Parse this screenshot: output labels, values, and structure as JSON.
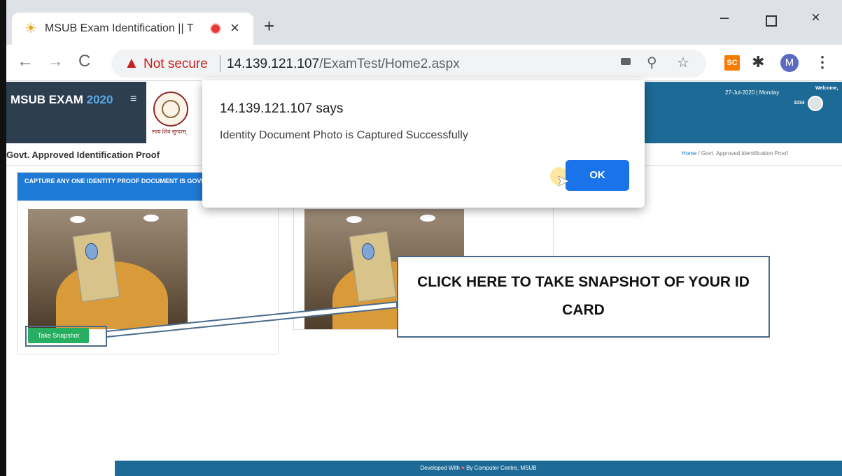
{
  "browser": {
    "tab_title": "MSUB Exam Identification || T",
    "tab_close": "×",
    "new_tab": "+",
    "window_minimize": "–",
    "window_close": "×",
    "nav_back": "←",
    "nav_forward": "→",
    "nav_reload": "C",
    "security_warning": "Not secure",
    "url_host": "14.139.121.107",
    "url_path": "/ExamTest/Home2.aspx",
    "extension_sc": "SC",
    "profile_initial": "M",
    "menu_glyph": "⋮",
    "icons": [
      "sun-favicon-icon",
      "recording-icon",
      "warning-icon",
      "camera-icon",
      "zoom-icon",
      "star-icon",
      "puzzle-icon"
    ]
  },
  "header": {
    "brand_name": "MSUB EXAM",
    "brand_year": "2020",
    "hamburger": "≡",
    "logo_caption": "सत्यं शिवं सुन्दरम्",
    "date": "27-Jul-2020 | Monday",
    "welcome": "Welcome,",
    "user_id": "1034"
  },
  "page": {
    "title": "Govt. Approved Identification Proof",
    "breadcrumb_home": "Home",
    "breadcrumb_sep": "/",
    "breadcrumb_current": "Govt. Approved Identification Proof"
  },
  "panel1": {
    "heading": "CAPTURE ANY ONE IDENTITY PROOF DOCUMENT IS GOVERNMENT",
    "snapshot_button": "Take Snapshot"
  },
  "callout": {
    "text": "CLICK HERE TO TAKE SNAPSHOT OF YOUR ID CARD"
  },
  "footer": {
    "prefix": "Developed With",
    "heart": "♥",
    "suffix": "By Computer Centre, MSUB"
  },
  "alert": {
    "title": "14.139.121.107 says",
    "message": "Identity Document Photo is Captured Successfully",
    "ok_label": "OK"
  },
  "colors": {
    "header_blue": "#1d6a96",
    "brand_dark": "#2d3e50",
    "panel_head_blue": "#1f7ad6",
    "snapshot_green": "#27ae60",
    "ok_button_blue": "#1a73e8",
    "not_secure_red": "#c5221f"
  }
}
